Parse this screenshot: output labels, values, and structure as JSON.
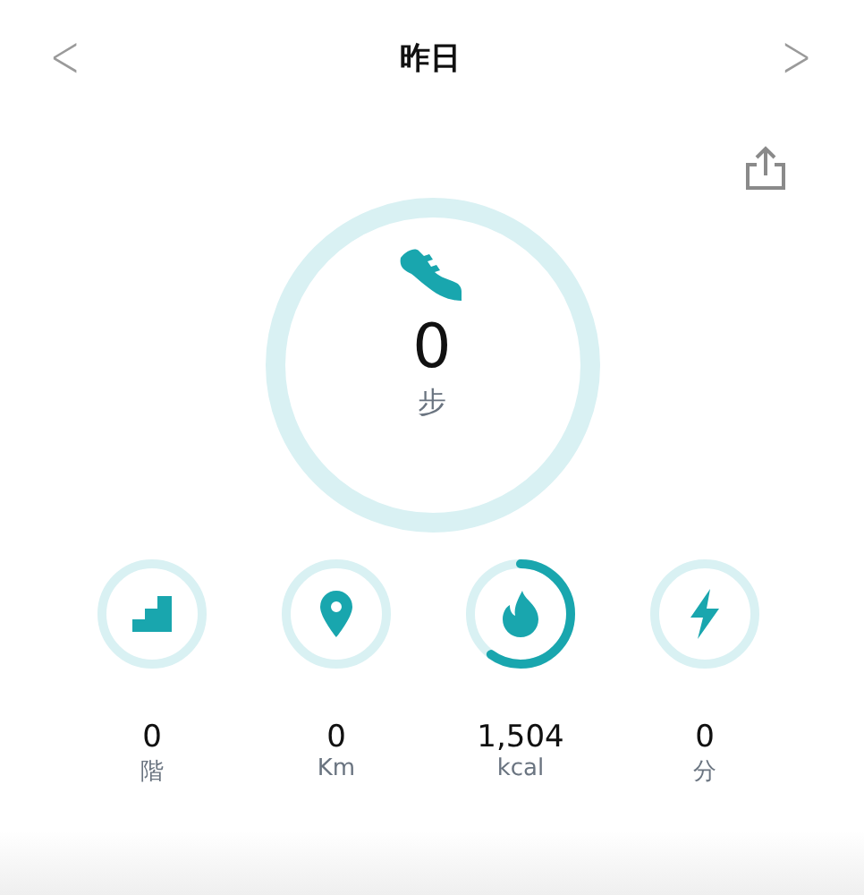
{
  "header": {
    "title": "昨日",
    "prev": "<",
    "next": ">"
  },
  "steps": {
    "value": "0",
    "unit": "步"
  },
  "metrics": [
    {
      "kind": "floors",
      "value": "0",
      "unit": "階"
    },
    {
      "kind": "distance",
      "value": "0",
      "unit": "Km"
    },
    {
      "kind": "calories",
      "value": "1,504",
      "unit": "kcal"
    },
    {
      "kind": "active",
      "value": "0",
      "unit": "分"
    }
  ]
}
